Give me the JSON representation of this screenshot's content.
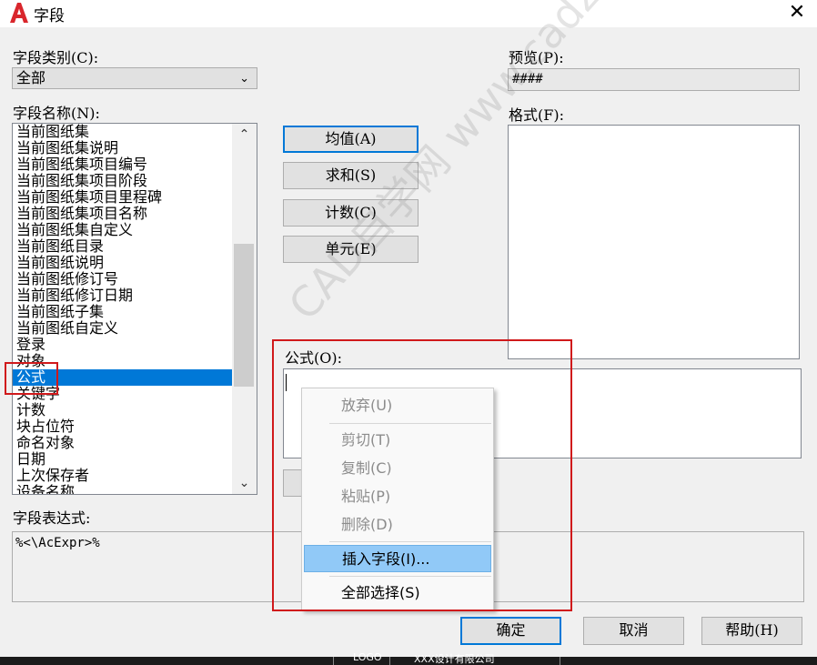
{
  "window": {
    "title": "字段",
    "close_glyph": "✕",
    "app_icon": "autocad-logo-icon",
    "app_icon_color": "#d9262c"
  },
  "category": {
    "label": "字段类别(C):",
    "selected": "全部"
  },
  "field_names": {
    "label": "字段名称(N):",
    "items": [
      "当前图纸集",
      "当前图纸集说明",
      "当前图纸集项目编号",
      "当前图纸集项目阶段",
      "当前图纸集项目里程碑",
      "当前图纸集项目名称",
      "当前图纸集自定义",
      "当前图纸目录",
      "当前图纸说明",
      "当前图纸修订号",
      "当前图纸修订日期",
      "当前图纸子集",
      "当前图纸自定义",
      "登录",
      "对象",
      "公式",
      "关键字",
      "计数",
      "块占位符",
      "命名对象",
      "日期",
      "上次保存者",
      "设备名称"
    ],
    "selected_index": 15
  },
  "function_buttons": [
    {
      "label": "均值(A)"
    },
    {
      "label": "求和(S)"
    },
    {
      "label": "计数(C)"
    },
    {
      "label": "单元(E)"
    }
  ],
  "preview": {
    "label": "预览(P):",
    "value": "####"
  },
  "format": {
    "label": "格式(F):"
  },
  "formula": {
    "label": "公式(O):",
    "value": ""
  },
  "expression": {
    "label": "字段表达式:",
    "value": "%<\\AcExpr>%"
  },
  "context_menu": {
    "items": [
      {
        "label": "放弃(U)",
        "enabled": false
      },
      {
        "label": "剪切(T)",
        "enabled": false
      },
      {
        "label": "复制(C)",
        "enabled": false
      },
      {
        "label": "粘贴(P)",
        "enabled": false
      },
      {
        "label": "删除(D)",
        "enabled": false
      },
      {
        "label": "插入字段(I)...",
        "enabled": true,
        "highlighted": true
      },
      {
        "label": "全部选择(S)",
        "enabled": true
      }
    ]
  },
  "footer": {
    "ok": "确定",
    "cancel": "取消",
    "help": "帮助(H)"
  },
  "watermark": "CAD自学网 www.cadzxw.com",
  "bottom_strip": {
    "logo_text": "LOGO",
    "company_text": "XXX设计有限公司"
  },
  "colors": {
    "selection": "#0078d7",
    "highlight_box": "#d0191b",
    "menu_highlight": "#91c9f7"
  }
}
